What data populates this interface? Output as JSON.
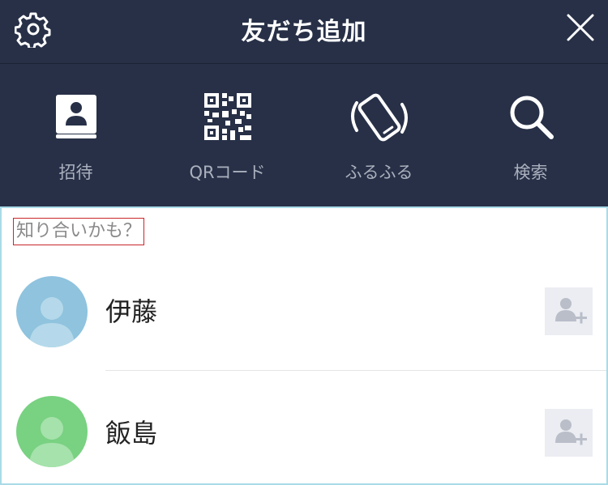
{
  "header": {
    "title": "友だち追加",
    "settings_icon": "gear-icon",
    "close_icon": "close-icon"
  },
  "actions": [
    {
      "label": "招待",
      "icon": "contacts-book-icon"
    },
    {
      "label": "QRコード",
      "icon": "qr-code-icon"
    },
    {
      "label": "ふるふる",
      "icon": "shaking-phone-icon"
    },
    {
      "label": "検索",
      "icon": "search-icon"
    }
  ],
  "suggestions": {
    "title": "知り合いかも？",
    "people": [
      {
        "name": "伊藤",
        "avatar_color": "#8fc3de"
      },
      {
        "name": "飯島",
        "avatar_color": "#79d182"
      }
    ]
  },
  "colors": {
    "header_bg": "#273047",
    "panel_border": "#a9dbe7",
    "highlight_box": "#c9262b"
  }
}
